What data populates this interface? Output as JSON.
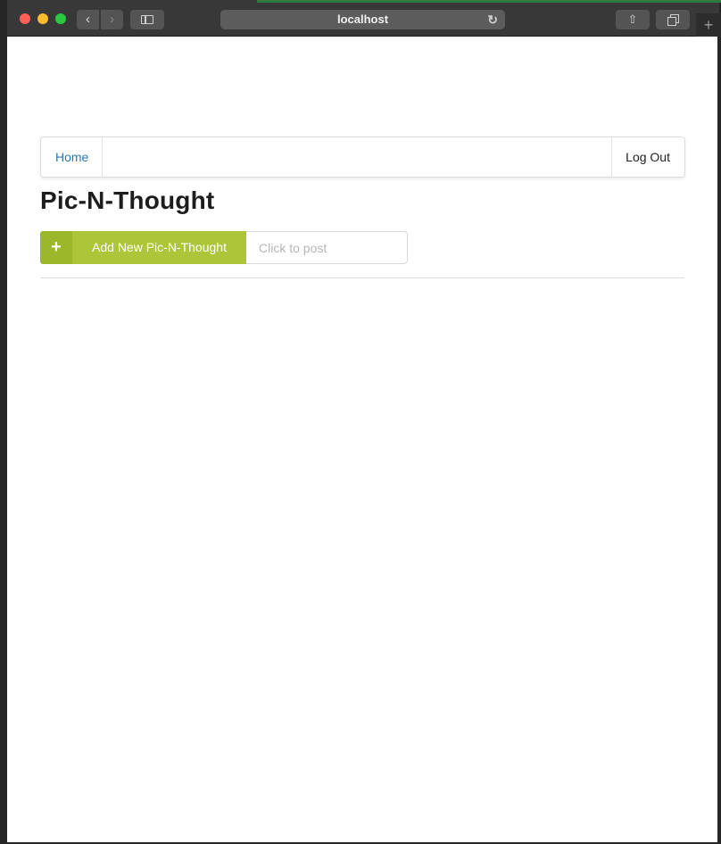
{
  "browser": {
    "address": "localhost",
    "back_glyph": "‹",
    "forward_glyph": "›",
    "reload_glyph": "↻",
    "share_glyph": "⇧",
    "newtab_glyph": "+"
  },
  "navbar": {
    "home_label": "Home",
    "logout_label": "Log Out"
  },
  "page": {
    "title": "Pic-N-Thought"
  },
  "post": {
    "add_icon": "+",
    "add_label": "Add New Pic-N-Thought",
    "input_placeholder": "Click to post",
    "input_value": ""
  },
  "colors": {
    "accent_green": "#adc538",
    "accent_green_dark": "#9ab82a",
    "link_blue": "#2a7ab4"
  }
}
